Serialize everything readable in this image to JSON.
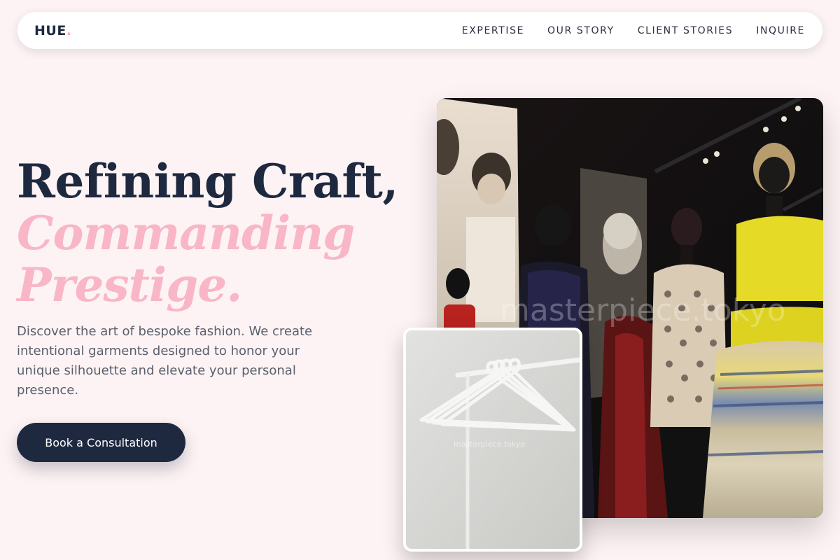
{
  "brand": {
    "name": "HUE",
    "dot": "."
  },
  "nav": {
    "links": [
      "EXPERTISE",
      "OUR STORY",
      "CLIENT STORIES",
      "INQUIRE"
    ]
  },
  "hero": {
    "line1": "Refining Craft,",
    "line2": "Commanding",
    "line3": "Prestige.",
    "description": "Discover the art of bespoke fashion. We create intentional garments designed to honor your unique silhouette and elevate your personal presence.",
    "cta_label": "Book a Consultation"
  },
  "images": {
    "main_watermark": "masterpiece.tokyo",
    "inset_watermark": "masterpiece.tokyo"
  },
  "colors": {
    "background": "#fdf3f4",
    "navy": "#1e2940",
    "pink_accent": "#f9b6c7",
    "body_text": "#5a5f6c"
  }
}
